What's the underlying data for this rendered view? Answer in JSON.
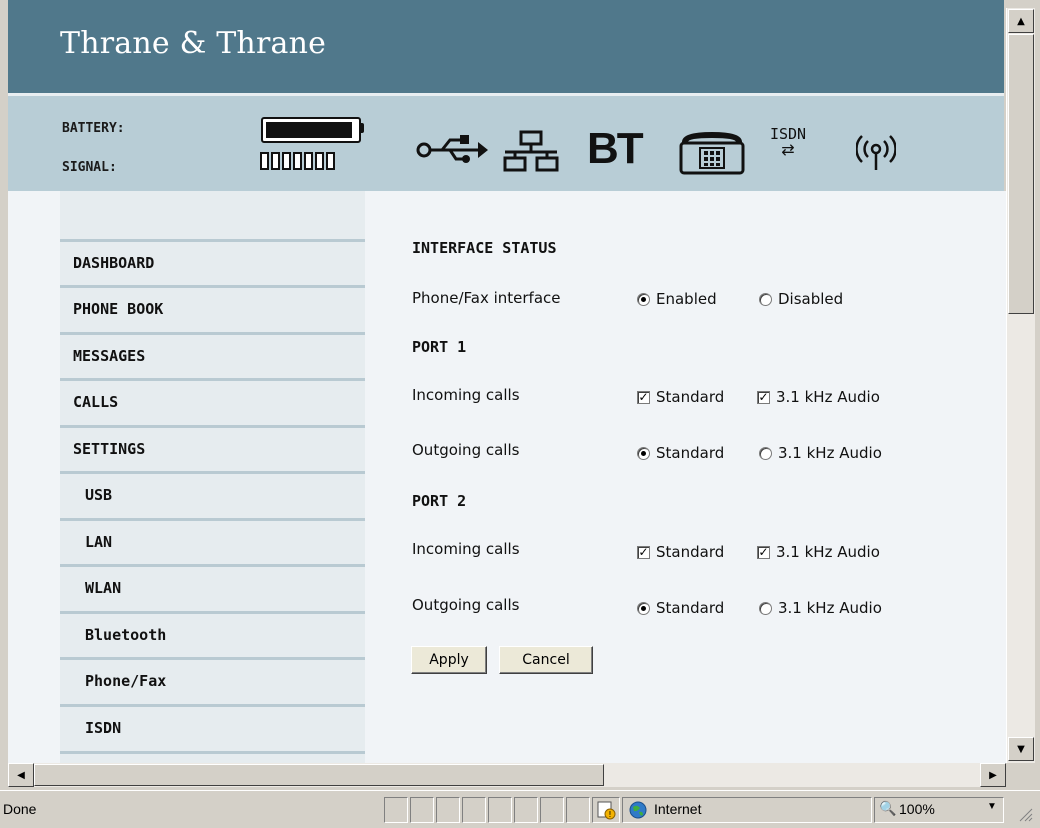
{
  "brand": "Thrane & Thrane",
  "status": {
    "battery_label": "BATTERY:",
    "signal_label": "SIGNAL:",
    "battery_level": 0.9,
    "signal_bars_total": 7
  },
  "interface_icons": {
    "usb": "usb-icon",
    "lan": "lan-icon",
    "bt": "BT",
    "phone": "phone-icon",
    "isdn": "ISDN",
    "wlan": "wlan-icon"
  },
  "nav": {
    "items": [
      {
        "label": "DASHBOARD",
        "level": "main"
      },
      {
        "label": "PHONE BOOK",
        "level": "main"
      },
      {
        "label": "MESSAGES",
        "level": "main"
      },
      {
        "label": "CALLS",
        "level": "main"
      },
      {
        "label": "SETTINGS",
        "level": "main"
      },
      {
        "label": "USB",
        "level": "sub"
      },
      {
        "label": "LAN",
        "level": "sub"
      },
      {
        "label": "WLAN",
        "level": "sub"
      },
      {
        "label": "Bluetooth",
        "level": "sub"
      },
      {
        "label": "Phone/Fax",
        "level": "sub"
      },
      {
        "label": "ISDN",
        "level": "sub"
      }
    ]
  },
  "form": {
    "interface_status_heading": "INTERFACE STATUS",
    "phonefax_label": "Phone/Fax interface",
    "enabled": "Enabled",
    "disabled": "Disabled",
    "port1_heading": "PORT 1",
    "port2_heading": "PORT 2",
    "incoming_label": "Incoming calls",
    "outgoing_label": "Outgoing calls",
    "standard": "Standard",
    "audio": "3.1 kHz Audio",
    "apply": "Apply",
    "cancel": "Cancel"
  },
  "browser_status": {
    "done": "Done",
    "zone": "Internet",
    "zoom": "100%"
  }
}
